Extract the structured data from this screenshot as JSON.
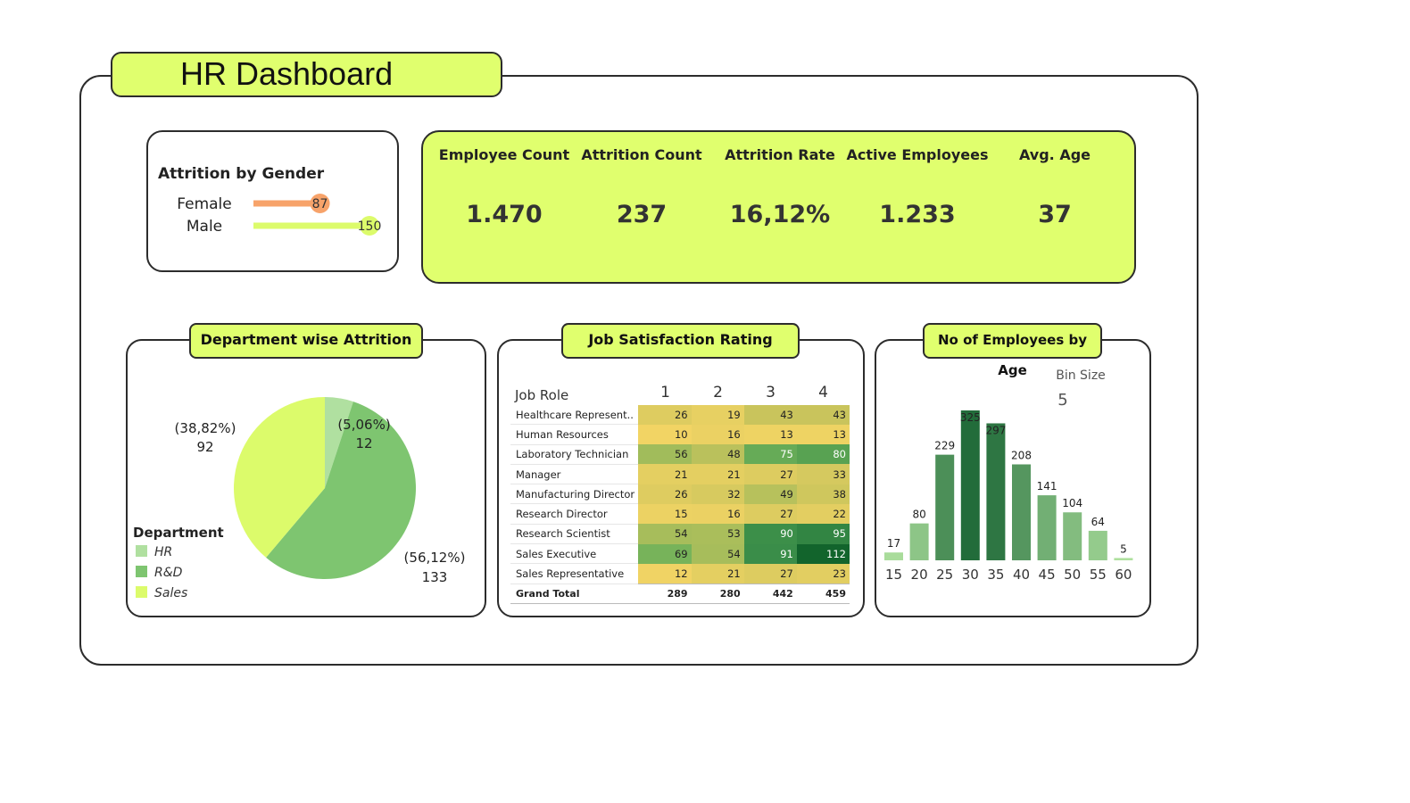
{
  "title": "HR Dashboard",
  "colors": {
    "accent": "#e0ff6e",
    "female": "#f7a36a",
    "male": "#dcfb6b"
  },
  "gender": {
    "title": "Attrition by Gender",
    "rows": [
      {
        "label": "Female",
        "value": 87
      },
      {
        "label": "Male",
        "value": 150
      }
    ]
  },
  "kpis": [
    {
      "label": "Employee Count",
      "value": "1.470"
    },
    {
      "label": "Attrition Count",
      "value": "237"
    },
    {
      "label": "Attrition Rate",
      "value": "16,12%"
    },
    {
      "label": "Active Employees",
      "value": "1.233"
    },
    {
      "label": "Avg. Age",
      "value": "37"
    }
  ],
  "dept": {
    "title": "Department wise Attrition",
    "legend_title": "Department",
    "legend": [
      {
        "label": "HR",
        "color": "#b0e0a0"
      },
      {
        "label": "R&D",
        "color": "#7ec570"
      },
      {
        "label": "Sales",
        "color": "#dcfb6b"
      }
    ],
    "slice_labels": [
      {
        "pct": "(5,06%)",
        "value": "12"
      },
      {
        "pct": "(56,12%)",
        "value": "133"
      },
      {
        "pct": "(38,82%)",
        "value": "92"
      }
    ]
  },
  "job": {
    "title": "Job Satisfaction Rating",
    "row_header": "Job Role",
    "columns": [
      "1",
      "2",
      "3",
      "4"
    ],
    "total_label": "Grand Total",
    "totals": [
      289,
      280,
      442,
      459
    ]
  },
  "age": {
    "title": "No of Employees by Age",
    "bin_label": "Bin Size",
    "bin_value": "5"
  },
  "chart_data": [
    {
      "type": "bar",
      "title": "Attrition by Gender",
      "categories": [
        "Female",
        "Male"
      ],
      "values": [
        87,
        150
      ]
    },
    {
      "type": "pie",
      "title": "Department wise Attrition",
      "categories": [
        "HR",
        "R&D",
        "Sales"
      ],
      "values": [
        12,
        133,
        92
      ],
      "percentages": [
        "5,06%",
        "56,12%",
        "38,82%"
      ]
    },
    {
      "type": "heatmap",
      "title": "Job Satisfaction Rating",
      "rows": [
        "Healthcare Represent..",
        "Human Resources",
        "Laboratory Technician",
        "Manager",
        "Manufacturing Director",
        "Research Director",
        "Research Scientist",
        "Sales Executive",
        "Sales Representative"
      ],
      "columns": [
        "1",
        "2",
        "3",
        "4"
      ],
      "values": [
        [
          26,
          19,
          43,
          43
        ],
        [
          10,
          16,
          13,
          13
        ],
        [
          56,
          48,
          75,
          80
        ],
        [
          21,
          21,
          27,
          33
        ],
        [
          26,
          32,
          49,
          38
        ],
        [
          15,
          16,
          27,
          22
        ],
        [
          54,
          53,
          90,
          95
        ],
        [
          69,
          54,
          91,
          112
        ],
        [
          12,
          21,
          27,
          23
        ]
      ]
    },
    {
      "type": "bar",
      "title": "No of Employees by Age",
      "categories": [
        "15",
        "20",
        "25",
        "30",
        "35",
        "40",
        "45",
        "50",
        "55",
        "60"
      ],
      "values": [
        17,
        80,
        229,
        325,
        297,
        208,
        141,
        104,
        64,
        5
      ]
    }
  ]
}
